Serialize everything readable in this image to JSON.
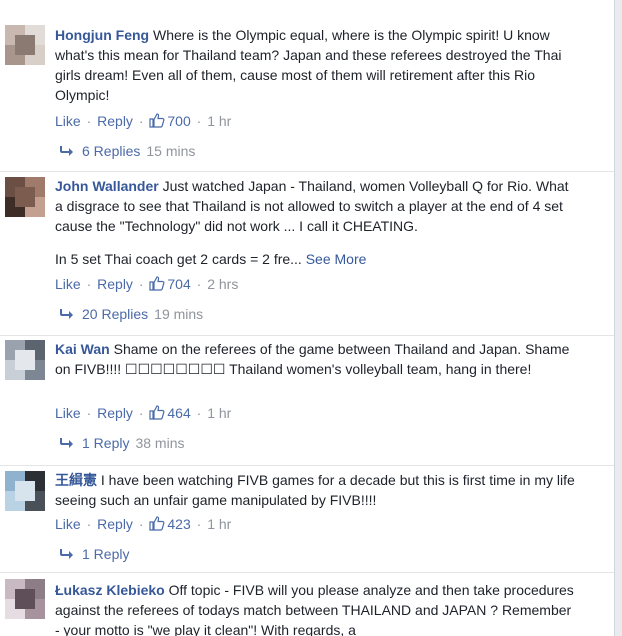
{
  "comments": [
    {
      "name": "Hongjun Feng",
      "text": "Where is the Olympic equal, where is the Olympic spirit! U know what's this mean for Thailand team? Japan and these referees destroyed the Thai girls dream! Even all of them, cause most of them will retirement after this Rio Olympic!",
      "like_label": "Like",
      "reply_label": "Reply",
      "likes": "700",
      "time": "1 hr",
      "replies_label": "6 Replies",
      "replies_time": "15 mins",
      "avatar_colors": [
        "#c8b8b0",
        "#e2dcd8",
        "#a8968d",
        "#d9cfc9",
        "#8b7a72"
      ]
    },
    {
      "name": "John Wallander",
      "text": "Just watched Japan - Thailand, women Volleyball Q for Rio. What a disgrace to see that Thailand is not allowed to switch a player at the end of 4 set cause the \"Technology\" did not work ... I call it CHEATING.",
      "text2": "In 5 set Thai coach get 2 cards = 2 fre...",
      "see_more": "See More",
      "like_label": "Like",
      "reply_label": "Reply",
      "likes": "704",
      "time": "2 hrs",
      "replies_label": "20 Replies",
      "replies_time": "19 mins",
      "avatar_colors": [
        "#6b4f45",
        "#a07a6a",
        "#3e2c26",
        "#c4a090",
        "#7d5c50"
      ]
    },
    {
      "name": "Kai Wan",
      "text": "Shame on the referees of the game between Thailand and Japan. Shame on FIVB!!!! ☐☐☐☐☐☐☐☐ Thailand women's volleyball team, hang in there!",
      "like_label": "Like",
      "reply_label": "Reply",
      "likes": "464",
      "time": "1 hr",
      "replies_label": "1 Reply",
      "replies_time": "38 mins",
      "avatar_colors": [
        "#9aa2ad",
        "#5c6470",
        "#c9cfd6",
        "#7d8794",
        "#e4e7eb"
      ]
    },
    {
      "name": "王緝憲",
      "text": "I have been watching FIVB games for a decade but this is first time in my life seeing such an unfair game manipulated by FIVB!!!!",
      "like_label": "Like",
      "reply_label": "Reply",
      "likes": "423",
      "time": "1 hr",
      "replies_label": "1 Reply",
      "replies_time": "",
      "avatar_colors": [
        "#8fb3cf",
        "#2c2f33",
        "#b9d2e4",
        "#4a5058",
        "#d7e4ee"
      ]
    },
    {
      "name": "Łukasz Klebieko",
      "text": "Off topic - FIVB will you please analyze and then take procedures against the referees of todays match between THAILAND and JAPAN ? Remember - your motto is \"we play it clean\"! With regards, a",
      "avatar_colors": [
        "#c9b9c2",
        "#8d7d86",
        "#e6dde2",
        "#a6939d",
        "#5f4f58"
      ]
    }
  ]
}
